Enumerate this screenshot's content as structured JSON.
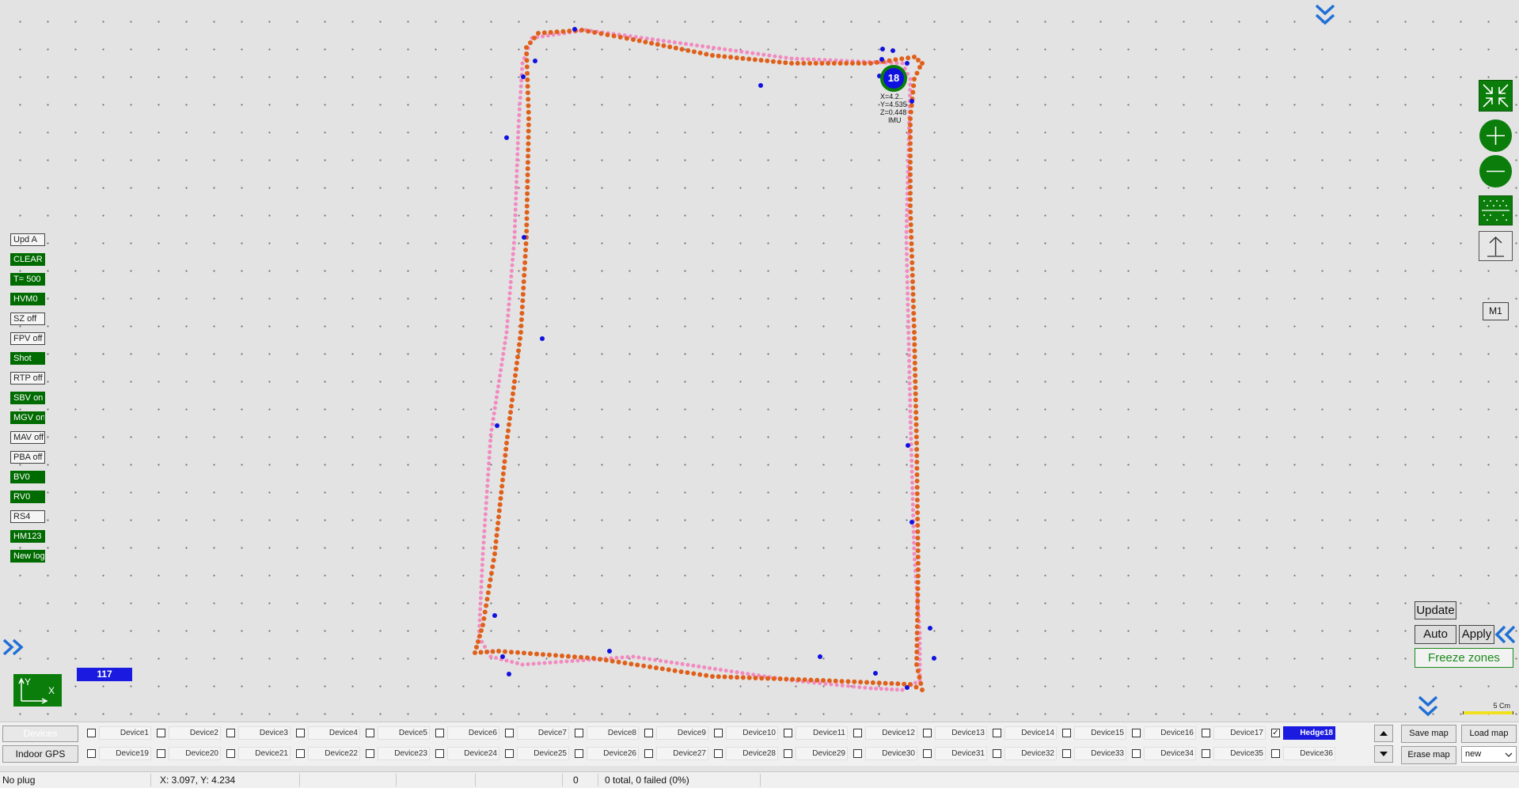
{
  "side_buttons": [
    {
      "label": "Upd A",
      "state": "off"
    },
    {
      "label": "CLEAR",
      "state": "on"
    },
    {
      "label": "T= 500",
      "state": "on"
    },
    {
      "label": "HVM0",
      "state": "on"
    },
    {
      "label": "SZ off",
      "state": "off"
    },
    {
      "label": "FPV off",
      "state": "off"
    },
    {
      "label": "Shot",
      "state": "on"
    },
    {
      "label": "RTP off",
      "state": "off"
    },
    {
      "label": "SBV on",
      "state": "on"
    },
    {
      "label": "MGV on",
      "state": "on"
    },
    {
      "label": "MAV off",
      "state": "off"
    },
    {
      "label": "PBA off",
      "state": "off"
    },
    {
      "label": "BV0",
      "state": "on"
    },
    {
      "label": "RV0",
      "state": "on"
    },
    {
      "label": "RS4",
      "state": "off"
    },
    {
      "label": "HM123",
      "state": "on"
    },
    {
      "label": "New log",
      "state": "on"
    }
  ],
  "counter": "117",
  "axes": {
    "y": "Y",
    "x": "X"
  },
  "hedgehog": {
    "id": "18",
    "x_text": "X=4.2..",
    "y_text": "Y=4.535",
    "z_text": "Z=0.448",
    "mode": "IMU"
  },
  "right_panel": {
    "m1_label": "M1",
    "update_label": "Update",
    "auto_label": "Auto",
    "apply_label": "Apply",
    "freeze_label": "Freeze zones",
    "scale_label": "5 Cm"
  },
  "left_buttons": {
    "top_label": "Devices",
    "bottom_label": "Indoor GPS"
  },
  "devices_row1": [
    {
      "name": "Device1",
      "checked": false
    },
    {
      "name": "Device2",
      "checked": false
    },
    {
      "name": "Device3",
      "checked": false
    },
    {
      "name": "Device4",
      "checked": false
    },
    {
      "name": "Device5",
      "checked": false
    },
    {
      "name": "Device6",
      "checked": false
    },
    {
      "name": "Device7",
      "checked": false
    },
    {
      "name": "Device8",
      "checked": false
    },
    {
      "name": "Device9",
      "checked": false
    },
    {
      "name": "Device10",
      "checked": false
    },
    {
      "name": "Device11",
      "checked": false
    },
    {
      "name": "Device12",
      "checked": false
    },
    {
      "name": "Device13",
      "checked": false
    },
    {
      "name": "Device14",
      "checked": false
    },
    {
      "name": "Device15",
      "checked": false
    },
    {
      "name": "Device16",
      "checked": false
    },
    {
      "name": "Device17",
      "checked": false
    },
    {
      "name": "Hedge18",
      "checked": true
    }
  ],
  "devices_row2": [
    {
      "name": "Device19",
      "checked": false
    },
    {
      "name": "Device20",
      "checked": false
    },
    {
      "name": "Device21",
      "checked": false
    },
    {
      "name": "Device22",
      "checked": false
    },
    {
      "name": "Device23",
      "checked": false
    },
    {
      "name": "Device24",
      "checked": false
    },
    {
      "name": "Device25",
      "checked": false
    },
    {
      "name": "Device26",
      "checked": false
    },
    {
      "name": "Device27",
      "checked": false
    },
    {
      "name": "Device28",
      "checked": false
    },
    {
      "name": "Device29",
      "checked": false
    },
    {
      "name": "Device30",
      "checked": false
    },
    {
      "name": "Device31",
      "checked": false
    },
    {
      "name": "Device32",
      "checked": false
    },
    {
      "name": "Device33",
      "checked": false
    },
    {
      "name": "Device34",
      "checked": false
    },
    {
      "name": "Device35",
      "checked": false
    },
    {
      "name": "Device36",
      "checked": false
    }
  ],
  "map_buttons": {
    "save": "Save map",
    "load": "Load map",
    "erase": "Erase map",
    "select_value": "new"
  },
  "status": {
    "plug": "No plug",
    "coords": "X: 3.097, Y: 4.234",
    "count": "0",
    "summary": "0 total, 0 failed (0%)"
  },
  "colors": {
    "accent_green": "#0a7d0a",
    "orange_track": "#e0601a",
    "pink_track": "#f28ac0",
    "beacon_blue": "#1010e0",
    "selected_blue": "#1a1ae0"
  }
}
